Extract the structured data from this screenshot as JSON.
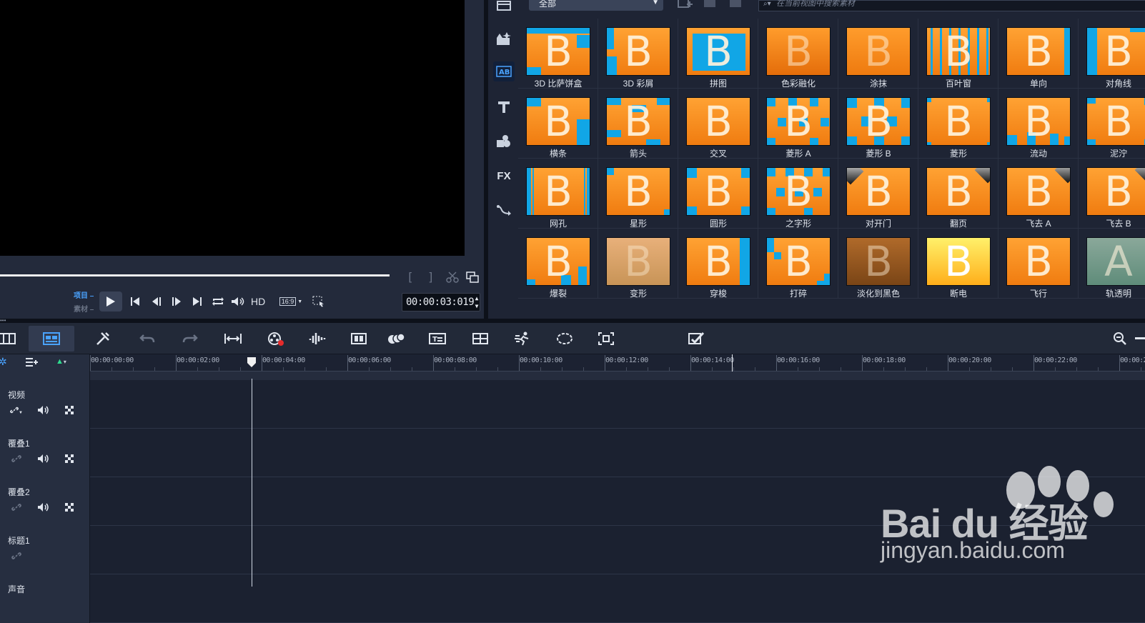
{
  "preview": {
    "project_label": "项目",
    "clip_label": "素材",
    "hd_label": "HD",
    "aspect_label": "16:9",
    "timecode": "00:00:03:019"
  },
  "library": {
    "category": "全部",
    "search_placeholder": "在当前视图中搜索素材",
    "items": [
      "3D 比萨饼盒",
      "3D 彩屑",
      "拼图",
      "色彩融化",
      "涂抹",
      "百叶窗",
      "单向",
      "对角线",
      "横条",
      "箭头",
      "交叉",
      "菱形 A",
      "菱形 B",
      "菱形",
      "流动",
      "泥泞",
      "网孔",
      "星形",
      "圆形",
      "之字形",
      "对开门",
      "翻页",
      "飞去 A",
      "飞去 B",
      "爆裂",
      "变形",
      "穿梭",
      "打碎",
      "淡化到黑色",
      "断电",
      "飞行",
      "轨透明"
    ]
  },
  "timeline": {
    "ruler_ticks": [
      "00:00:00:00",
      "00:00:02:00",
      "00:00:04:00",
      "00:00:06:00",
      "00:00:08:00",
      "00:00:10:00",
      "00:00:12:00",
      "00:00:14:00",
      "00:00:16:00",
      "00:00:18:00",
      "00:00:20:00",
      "00:00:22:00",
      "00:00:2"
    ],
    "tracks": [
      "视频",
      "覆叠1",
      "覆叠2",
      "标题1",
      "声音"
    ]
  },
  "watermark": {
    "brand": "Bai du 经验",
    "url": "jingyan.baidu.com"
  },
  "colors": {
    "accent": "#4aa3ff",
    "thumb_orange": "#f58a1f",
    "thumb_blue": "#11a6e6"
  }
}
